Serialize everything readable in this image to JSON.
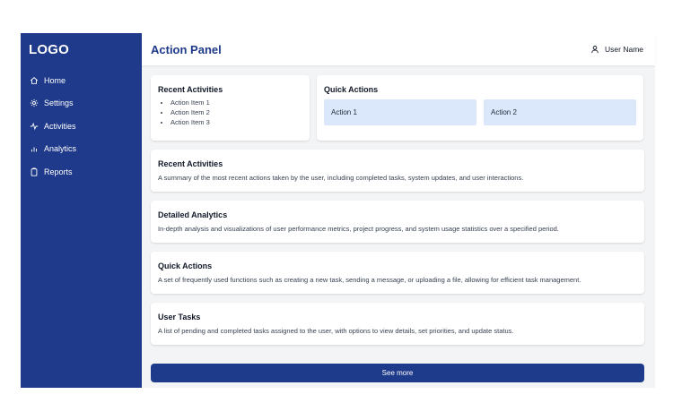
{
  "sidebar": {
    "logo": "LOGO",
    "items": [
      {
        "label": "Home",
        "icon": "home-icon"
      },
      {
        "label": "Settings",
        "icon": "gear-icon"
      },
      {
        "label": "Activities",
        "icon": "activity-icon"
      },
      {
        "label": "Analytics",
        "icon": "bar-chart-icon"
      },
      {
        "label": "Reports",
        "icon": "clipboard-icon"
      }
    ]
  },
  "header": {
    "title": "Action Panel",
    "user_name": "User Name",
    "user_icon": "user-icon"
  },
  "recent_card": {
    "title": "Recent Activities",
    "items": [
      "Action Item 1",
      "Action Item 2",
      "Action Item 3"
    ]
  },
  "quick_card": {
    "title": "Quick Actions",
    "actions": [
      "Action 1",
      "Action 2"
    ]
  },
  "sections": [
    {
      "title": "Recent Activities",
      "description": "A summary of the most recent actions taken by the user, including completed tasks, system updates, and user interactions."
    },
    {
      "title": "Detailed Analytics",
      "description": "In-depth analysis and visualizations of user performance metrics, project progress, and system usage statistics over a specified period."
    },
    {
      "title": "Quick Actions",
      "description": "A set of frequently used functions such as creating a new task, sending a message, or uploading a file, allowing for efficient task management."
    },
    {
      "title": "User Tasks",
      "description": "A list of pending and completed tasks assigned to the user, with options to view details, set priorities, and update status."
    }
  ],
  "see_more_label": "See more",
  "colors": {
    "sidebar_bg": "#1f3a8a",
    "accent": "#1e3a8a",
    "action_bg": "#dbe7fb",
    "main_bg": "#f3f4f6"
  }
}
